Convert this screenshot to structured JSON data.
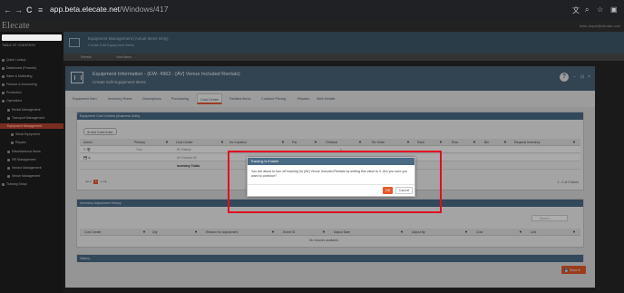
{
  "browser": {
    "nav_back": "←",
    "nav_forward": "→",
    "nav_reload": "C",
    "nav_tune": "≡",
    "url_host": "app.beta.elecate.net",
    "url_path": "/Windows/417",
    "right_icons": [
      "translate-icon",
      "zoom-icon",
      "star-icon",
      "extensions-icon"
    ]
  },
  "app": {
    "logo": "Elecate",
    "user": "hello.depot@elecate.com"
  },
  "sidebar": {
    "items": [
      {
        "label": "TABLE OF CONTENTS"
      },
      {
        "label": "Quick Lookup"
      },
      {
        "label": "Dashboard (Powerbi)"
      },
      {
        "label": "Sales & Marketing"
      },
      {
        "label": "Finance & Accounting"
      },
      {
        "label": "Production"
      },
      {
        "label": "Operations"
      },
      {
        "label": "Rental Management"
      },
      {
        "label": "Transport Management"
      },
      {
        "label": "Equipment Management"
      },
      {
        "label": "Serial Equipment"
      },
      {
        "label": "Repairs"
      },
      {
        "label": "Miscellaneous Items"
      },
      {
        "label": "HR Management"
      },
      {
        "label": "Vendor Management"
      },
      {
        "label": "Venue Management"
      },
      {
        "label": "Training Setup"
      }
    ]
  },
  "background": {
    "title": "Equipment Management (Actual Items Only)",
    "subtitle": "Create Edit Equipment Items",
    "buttons": [
      "Refresh",
      "View Items"
    ]
  },
  "modal": {
    "title": "Equipment Information - (EW- 4962 - [AV] Venue Included Rentals)",
    "subtitle": "Create Edit Equipment Items",
    "help": "?",
    "header_buttons": [
      "–",
      "⊡",
      "×"
    ],
    "tabs": [
      "Equipment Item",
      "Inventory Rules",
      "Descriptions",
      "Purchasing",
      "Cost Center",
      "Related Items",
      "Contract Pricing",
      "Repairs",
      "Web Details"
    ],
    "active_tab": "Cost Center",
    "cost_center": {
      "header": "Equipment Cost Centers (Business Units)",
      "add_button": "Add CostCenter",
      "columns": [
        "Action",
        "Primary",
        "Cost Center",
        "Inv Location",
        "Par",
        "OnHand",
        "Re Order",
        "Rack",
        "Row",
        "Bin",
        "Request Inventory"
      ],
      "rows": [
        {
          "primary": "True",
          "cost_center": "IN Orlando",
          "inv_location": "",
          "par": "",
          "onhand": "1",
          "reorder": ""
        },
        {
          "primary": "",
          "cost_center": "AH Orlando AV",
          "inv_location": "",
          "par": "",
          "onhand": "",
          "reorder": ""
        }
      ],
      "totals_label": "Inventory Totals",
      "page": "1",
      "items_text": "1 - 2 of 2 items"
    },
    "history": {
      "header": "Inventory Adjustment History",
      "search_placeholder": "Search...",
      "columns": [
        "Cost Center",
        "Qty",
        "Reason for Adjustment",
        "Event ID",
        "Adjust Date",
        "Adjust By",
        "Cost",
        "Unit"
      ],
      "empty_text": "No records available."
    },
    "history2": {
      "header": "History"
    },
    "save_button": "Save"
  },
  "dialog": {
    "title": "Tracking is Enable",
    "message": "You are about to turn off tracking for [AV] Venue Included Rentals by setting this value to 0. Are you sure you want to continue?",
    "ok": "OK",
    "cancel": "Cancel"
  },
  "colors": {
    "accent": "#e55a2b",
    "header_blue": "#4a6a86",
    "highlight": "#e00d22"
  }
}
